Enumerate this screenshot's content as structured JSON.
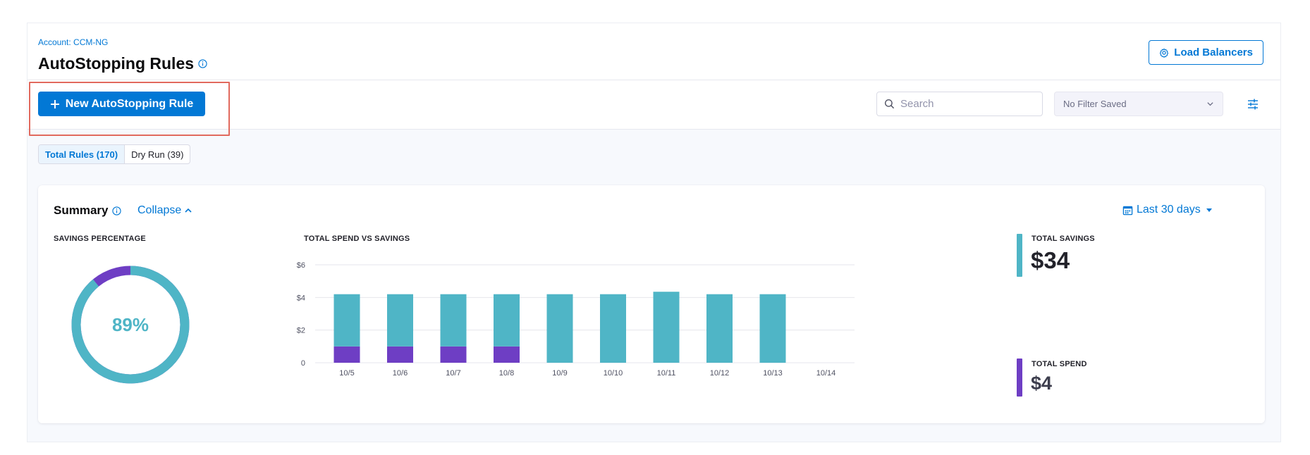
{
  "header": {
    "breadcrumb": "Account: CCM-NG",
    "title": "AutoStopping Rules",
    "load_balancers_label": "Load Balancers"
  },
  "toolbar": {
    "new_rule_label": "New AutoStopping Rule",
    "search_placeholder": "Search",
    "filter_value": "No Filter Saved"
  },
  "tabs": [
    {
      "label": "Total Rules (170)",
      "active": true
    },
    {
      "label": "Dry Run (39)",
      "active": false
    }
  ],
  "summary": {
    "title": "Summary",
    "collapse_label": "Collapse",
    "date_range": "Last 30 days",
    "savings_percentage_label": "SAVINGS PERCENTAGE",
    "savings_percentage_value": "89%",
    "savings_fraction": 0.89,
    "chart_label": "TOTAL SPEND VS SAVINGS",
    "total_savings_label": "TOTAL SAVINGS",
    "total_savings_value": "$34",
    "total_spend_label": "TOTAL SPEND",
    "total_spend_value": "$4"
  },
  "colors": {
    "accent": "#0278d5",
    "savings": "#4fb5c6",
    "spend": "#6e3ec4",
    "highlight": "#e16a5e"
  },
  "icons": {
    "plus": "plus-icon",
    "gear": "gear-icon",
    "search": "search-icon",
    "chevron": "chevron-down-icon",
    "filter": "sliders-icon",
    "calendar": "calendar-icon",
    "info": "info-icon"
  },
  "chart_data": {
    "type": "bar",
    "stacked": true,
    "categories": [
      "10/5",
      "10/6",
      "10/7",
      "10/8",
      "10/9",
      "10/10",
      "10/11",
      "10/12",
      "10/13",
      "10/14"
    ],
    "series": [
      {
        "values": [
          1.0,
          1.0,
          1.0,
          1.0,
          0,
          0,
          0,
          0,
          0,
          0
        ],
        "color": "#6e3ec4"
      },
      {
        "values": [
          3.2,
          3.2,
          3.2,
          3.2,
          4.2,
          4.2,
          4.35,
          4.2,
          4.2,
          0
        ],
        "color": "#4fb5c6"
      }
    ],
    "ylim": [
      0,
      6
    ],
    "yticks": [
      0,
      2,
      4,
      6
    ],
    "ytick_labels": [
      "0",
      "$2",
      "$4",
      "$6"
    ],
    "grid": true,
    "legend": "none"
  }
}
